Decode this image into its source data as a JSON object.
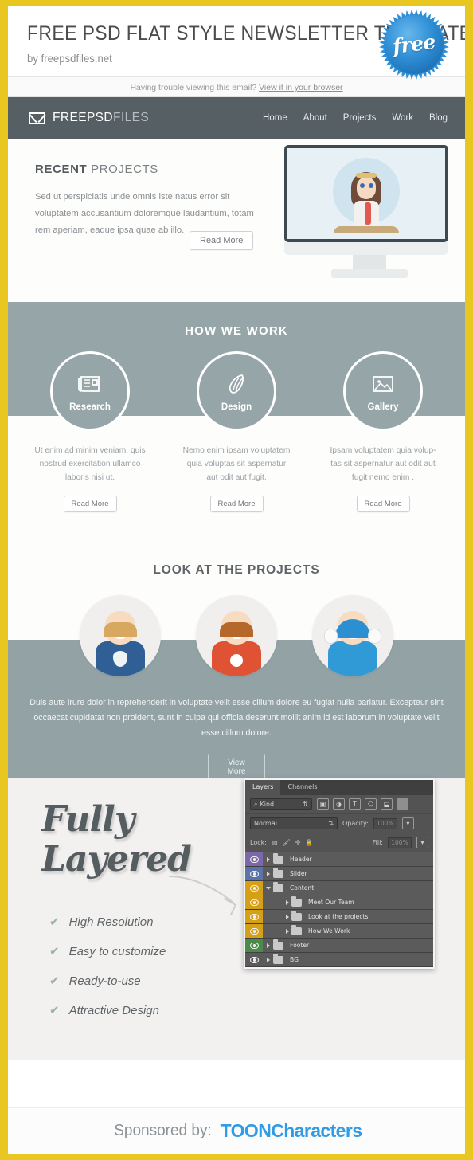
{
  "theme": {
    "frame_gold": "#e8c721",
    "nav_dark": "#565f64",
    "slate": "#96a5a7",
    "accent_blue": "#2f9ce8",
    "light_gray": "#f2f1f0"
  },
  "masthead": {
    "title": "FREE PSD FLAT STYLE NEWSLETTER TEMPLATE",
    "byline": "by freepsdfiles.net",
    "badge_text": "free"
  },
  "trouble_bar": {
    "text": "Having trouble viewing this email?",
    "link_label": "View it in your browser"
  },
  "nav": {
    "brand_bold": "FREEPSD",
    "brand_light": "FILES",
    "links": [
      {
        "label": "Home"
      },
      {
        "label": "About"
      },
      {
        "label": "Projects"
      },
      {
        "label": "Work"
      },
      {
        "label": "Blog"
      }
    ]
  },
  "recent": {
    "heading_bold": "RECENT",
    "heading_light": "PROJECTS",
    "body": "Sed ut perspiciatis unde omnis iste natus error sit voluptatem accusantium doloremque laudantium, totam rem aperiam, eaque ipsa quae ab illo.",
    "button_label": "Read More"
  },
  "how_we_work": {
    "heading": "HOW WE WORK",
    "items": [
      {
        "caption": "Research",
        "icon": "newspaper-icon",
        "body": "Ut enim ad minim veniam, quis nostrud exercitation ullamco laboris nisi ut.",
        "button_label": "Read More"
      },
      {
        "caption": "Design",
        "icon": "pen-nib-icon",
        "body": "Nemo enim ipsam voluptatem quia voluptas sit aspernatur aut odit aut fugit.",
        "button_label": "Read More"
      },
      {
        "caption": "Gallery",
        "icon": "image-icon",
        "body": "Ipsam voluptatem quia volup-tas sit aspernatur aut odit aut fugit nemo enim .",
        "button_label": "Read More"
      }
    ]
  },
  "look_at_projects": {
    "heading": "LOOK AT THE PROJECTS",
    "body": "Duis aute irure dolor in reprehenderit in voluptate velit esse cillum dolore eu fugiat nulla pariatur. Excepteur sint occaecat cupidatat non proident, sunt in culpa qui officia deserunt mollit anim id est laborum  in voluptate velit esse cillum dolore.",
    "button_label": "View More",
    "avatars": [
      {
        "name": "blue-hero-avatar"
      },
      {
        "name": "red-hero-avatar"
      },
      {
        "name": "yellow-hero-avatar"
      }
    ]
  },
  "fully_layered": {
    "title_line1": "Fully",
    "title_line2": "Layered",
    "features": [
      {
        "label": "High Resolution"
      },
      {
        "label": "Easy to customize"
      },
      {
        "label": "Ready-to-use"
      },
      {
        "label": "Attractive Design"
      }
    ],
    "check_glyph": "✔"
  },
  "photoshop_panel": {
    "tabs": [
      {
        "label": "Layers",
        "active": true
      },
      {
        "label": "Channels",
        "active": false
      }
    ],
    "filter_label": "Kind",
    "blend_mode": "Normal",
    "opacity_label": "Opacity:",
    "opacity_value": "100%",
    "lock_label": "Lock:",
    "fill_label": "Fill:",
    "fill_value": "100%",
    "filter_icons": [
      "image-icon",
      "adjustment-icon",
      "type-icon",
      "shape-icon",
      "smart-object-icon",
      "gradient-icon"
    ],
    "lock_icons": [
      "lock-transparency-icon",
      "lock-image-icon",
      "lock-position-icon",
      "lock-all-icon"
    ],
    "layers": [
      {
        "name": "Header",
        "color": "#7b68a8",
        "indent": 0,
        "expanded": false
      },
      {
        "name": "Slider",
        "color": "#5b73a8",
        "indent": 0,
        "expanded": false
      },
      {
        "name": "Content",
        "color": "#d4a017",
        "indent": 0,
        "expanded": true
      },
      {
        "name": "Meet Our Team",
        "color": "#d4a017",
        "indent": 1,
        "expanded": false
      },
      {
        "name": "Look at the projects",
        "color": "#d4a017",
        "indent": 1,
        "expanded": false
      },
      {
        "name": "How We Work",
        "color": "#d4a017",
        "indent": 1,
        "expanded": false
      },
      {
        "name": "Footer",
        "color": "#4c8a4c",
        "indent": 0,
        "expanded": false
      },
      {
        "name": "BG",
        "color": "#5b5b5b",
        "indent": 0,
        "expanded": false
      }
    ]
  },
  "sponsor": {
    "label": "Sponsored by:",
    "logo_text": "TOONCharacters"
  }
}
